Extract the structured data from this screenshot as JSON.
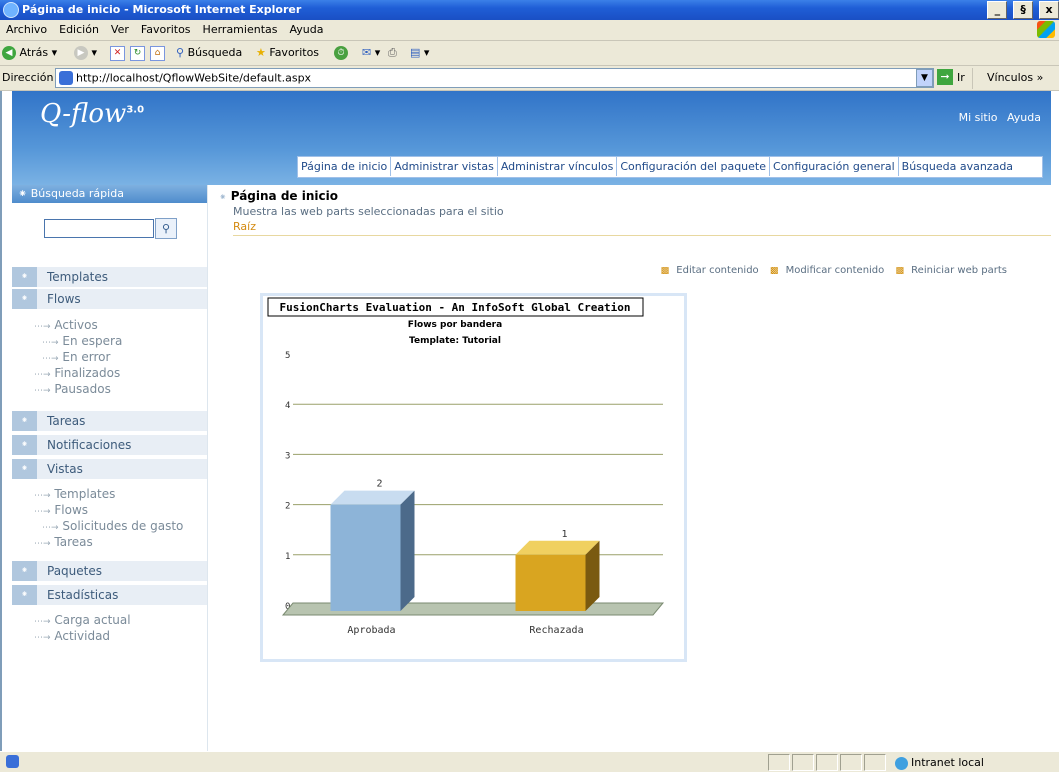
{
  "window": {
    "title": "Página de inicio - Microsoft Internet Explorer",
    "min": "_",
    "max": "§",
    "close": "x"
  },
  "menu": [
    "Archivo",
    "Edición",
    "Ver",
    "Favoritos",
    "Herramientas",
    "Ayuda"
  ],
  "toolbar": {
    "back": "Atrás",
    "search": "Búsqueda",
    "favorites": "Favoritos"
  },
  "address": {
    "label": "Dirección",
    "url": "http://localhost/QflowWebSite/default.aspx",
    "go": "Ir",
    "links": "Vínculos"
  },
  "app": {
    "logo": "Q-flow",
    "version": "3.0",
    "top_links": [
      "Mi sitio",
      "Ayuda"
    ],
    "nav": [
      "Página de inicio",
      "Administrar vistas",
      "Administrar vínculos",
      "Configuración del paquete",
      "Configuración general",
      "Búsqueda avanzada"
    ]
  },
  "sidebar": {
    "quick_search": "Búsqueda rápida",
    "sections": {
      "templates": "Templates",
      "flows": "Flows",
      "tareas": "Tareas",
      "notificaciones": "Notificaciones",
      "vistas": "Vistas",
      "paquetes": "Paquetes",
      "estadisticas": "Estadísticas"
    },
    "flows_items": [
      "Activos",
      "En espera",
      "En error",
      "Finalizados",
      "Pausados"
    ],
    "vistas_items": [
      "Templates",
      "Flows",
      "Solicitudes de gasto",
      "Tareas"
    ],
    "estadisticas_items": [
      "Carga actual",
      "Actividad"
    ]
  },
  "page": {
    "title": "Página de inicio",
    "description": "Muestra las web parts seleccionadas para el sitio",
    "breadcrumb": "Raíz",
    "actions": [
      "Editar contenido",
      "Modificar contenido",
      "Reiniciar web parts"
    ]
  },
  "chart_data": {
    "type": "bar",
    "watermark": "FusionCharts Evaluation - An InfoSoft Global Creation",
    "title": "Flows por bandera",
    "subtitle": "Template: Tutorial",
    "categories": [
      "Aprobada",
      "Rechazada"
    ],
    "values": [
      2,
      1
    ],
    "ylim": [
      0,
      5
    ],
    "yticks": [
      0,
      1,
      2,
      3,
      4,
      5
    ],
    "colors": [
      "#a8c8e8",
      "#e8b830"
    ]
  },
  "status": {
    "zone": "Intranet local"
  }
}
